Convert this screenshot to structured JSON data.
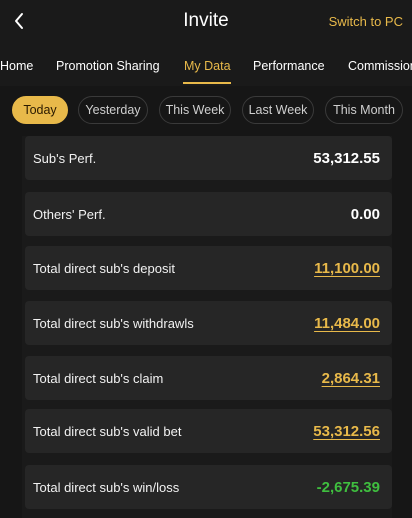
{
  "header": {
    "title": "Invite",
    "switch_label": "Switch to PC"
  },
  "tabs": [
    {
      "label": "Home"
    },
    {
      "label": "Promotion Sharing"
    },
    {
      "label": "My Data",
      "active": true
    },
    {
      "label": "Performance"
    },
    {
      "label": "Commission"
    }
  ],
  "periods": [
    {
      "label": "Today",
      "active": true
    },
    {
      "label": "Yesterday"
    },
    {
      "label": "This Week"
    },
    {
      "label": "Last Week"
    },
    {
      "label": "This Month"
    }
  ],
  "stats": [
    {
      "label": "Sub's Perf.",
      "value": "53,312.55",
      "style": "plain"
    },
    {
      "label": "Others' Perf.",
      "value": "0.00",
      "style": "plain"
    },
    {
      "label": "Total direct sub's deposit",
      "value": "11,100.00",
      "style": "link"
    },
    {
      "label": "Total direct sub's withdrawls",
      "value": "11,484.00",
      "style": "link"
    },
    {
      "label": "Total direct sub's claim",
      "value": "2,864.31",
      "style": "link"
    },
    {
      "label": "Total direct sub's valid bet",
      "value": "53,312.56",
      "style": "link"
    },
    {
      "label": "Total direct sub's win/loss",
      "value": "-2,675.39",
      "style": "negative"
    }
  ],
  "colors": {
    "accent": "#e8b94a",
    "negative": "#3fbf3f",
    "background": "#161616",
    "card": "#262626"
  },
  "icons": {
    "back": "chevron-left-icon"
  }
}
